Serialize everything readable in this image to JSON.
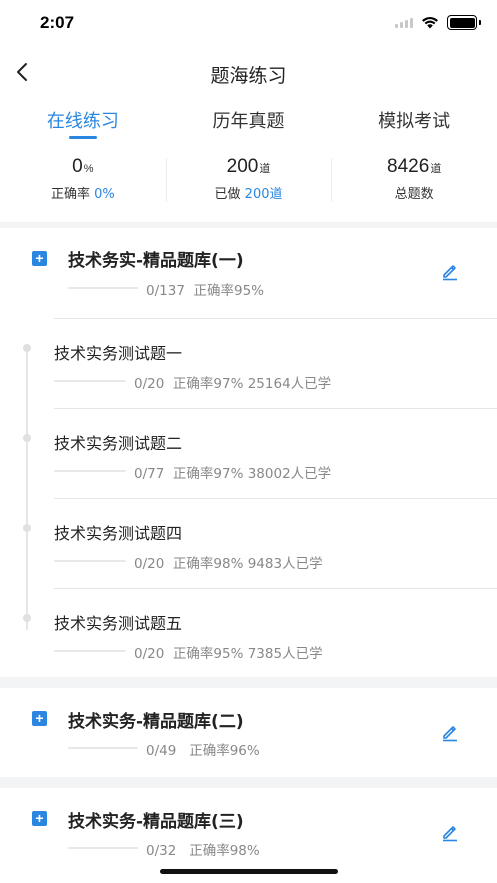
{
  "status": {
    "time": "2:07"
  },
  "navbar": {
    "title": "题海练习"
  },
  "tabs": [
    {
      "label": "在线练习",
      "active": true
    },
    {
      "label": "历年真题",
      "active": false
    },
    {
      "label": "模拟考试",
      "active": false
    }
  ],
  "stats": [
    {
      "value": "0",
      "unit": "%",
      "label": "正确率",
      "label_value": "0%"
    },
    {
      "value": "200",
      "unit": "道",
      "label": "已做",
      "label_value": "200道"
    },
    {
      "value": "8426",
      "unit": "道",
      "label": "总题数",
      "label_value": ""
    }
  ],
  "banks": [
    {
      "title": "技术务实-精品题库(一)",
      "progress": "0/137",
      "accuracy": "正确率95%",
      "expanded": true,
      "subs": [
        {
          "title": "技术实务测试题一",
          "progress": "0/20",
          "info": "正确率97% 25164人已学"
        },
        {
          "title": "技术实务测试题二",
          "progress": "0/77",
          "info": "正确率97% 38002人已学"
        },
        {
          "title": "技术实务测试题四",
          "progress": "0/20",
          "info": "正确率98% 9483人已学"
        },
        {
          "title": "技术实务测试题五",
          "progress": "0/20",
          "info": "正确率95% 7385人已学"
        }
      ]
    },
    {
      "title": "技术实务-精品题库(二)",
      "progress": "0/49",
      "accuracy": "正确率96%",
      "expanded": false
    },
    {
      "title": "技术实务-精品题库(三)",
      "progress": "0/32",
      "accuracy": "正确率98%",
      "expanded": false
    }
  ],
  "colors": {
    "accent": "#2a86e0",
    "muted": "#888888"
  },
  "icons": {
    "back": "chevron-left-icon",
    "expand": "plus-square-icon",
    "edit": "pencil-icon"
  }
}
